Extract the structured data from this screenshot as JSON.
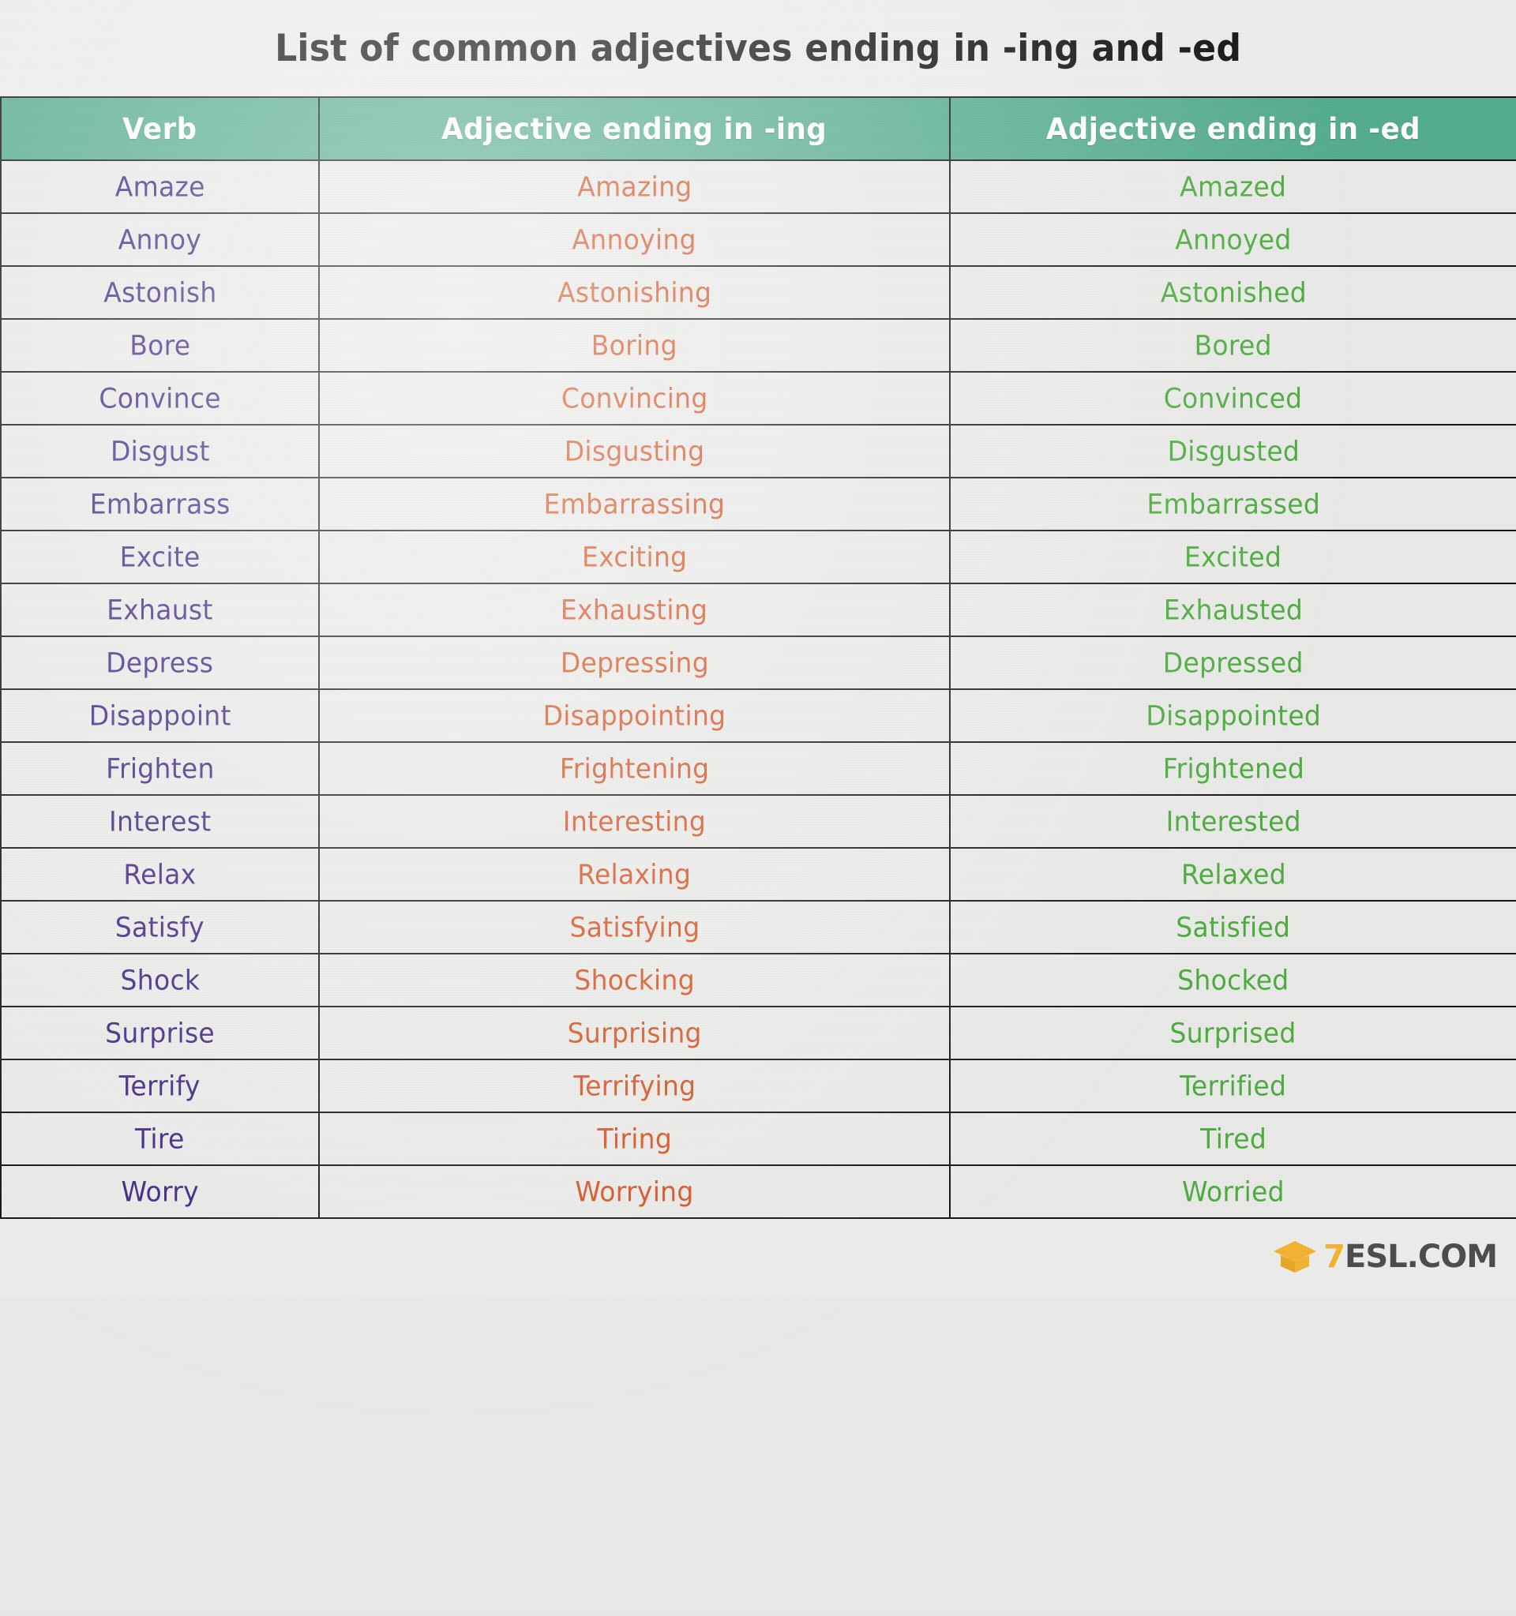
{
  "title": "List of common adjectives ending in -ing and -ed",
  "table": {
    "headers": [
      "Verb",
      "Adjective ending in -ing",
      "Adjective ending in -ed"
    ],
    "rows": [
      {
        "verb": "Amaze",
        "ing": "Amazing",
        "ed": "Amazed"
      },
      {
        "verb": "Annoy",
        "ing": "Annoying",
        "ed": "Annoyed"
      },
      {
        "verb": "Astonish",
        "ing": "Astonishing",
        "ed": "Astonished"
      },
      {
        "verb": "Bore",
        "ing": "Boring",
        "ed": "Bored"
      },
      {
        "verb": "Convince",
        "ing": "Convincing",
        "ed": "Convinced"
      },
      {
        "verb": "Disgust",
        "ing": "Disgusting",
        "ed": "Disgusted"
      },
      {
        "verb": "Embarrass",
        "ing": "Embarrassing",
        "ed": "Embarrassed"
      },
      {
        "verb": "Excite",
        "ing": "Exciting",
        "ed": "Excited"
      },
      {
        "verb": "Exhaust",
        "ing": "Exhausting",
        "ed": "Exhausted"
      },
      {
        "verb": "Depress",
        "ing": "Depressing",
        "ed": "Depressed"
      },
      {
        "verb": "Disappoint",
        "ing": "Disappointing",
        "ed": "Disappointed"
      },
      {
        "verb": "Frighten",
        "ing": "Frightening",
        "ed": "Frightened"
      },
      {
        "verb": "Interest",
        "ing": "Interesting",
        "ed": "Interested"
      },
      {
        "verb": "Relax",
        "ing": "Relaxing",
        "ed": "Relaxed"
      },
      {
        "verb": "Satisfy",
        "ing": "Satisfying",
        "ed": "Satisfied"
      },
      {
        "verb": "Shock",
        "ing": "Shocking",
        "ed": "Shocked"
      },
      {
        "verb": "Surprise",
        "ing": "Surprising",
        "ed": "Surprised"
      },
      {
        "verb": "Terrify",
        "ing": "Terrifying",
        "ed": "Terrified"
      },
      {
        "verb": "Tire",
        "ing": "Tiring",
        "ed": "Tired"
      },
      {
        "verb": "Worry",
        "ing": "Worrying",
        "ed": "Worried"
      }
    ]
  },
  "footer": {
    "logo_mark": "7",
    "logo_name": "ESL.COM"
  },
  "colors": {
    "header_green": "#52ab8d",
    "verb_purple": "#3c2080",
    "ing_orange": "#d4501e",
    "ed_green": "#4aab3b",
    "paper": "#e9e9e8",
    "grid_line": "#111111",
    "logo_yellow": "#f2b22e",
    "logo_gray": "#4a4a4a"
  }
}
